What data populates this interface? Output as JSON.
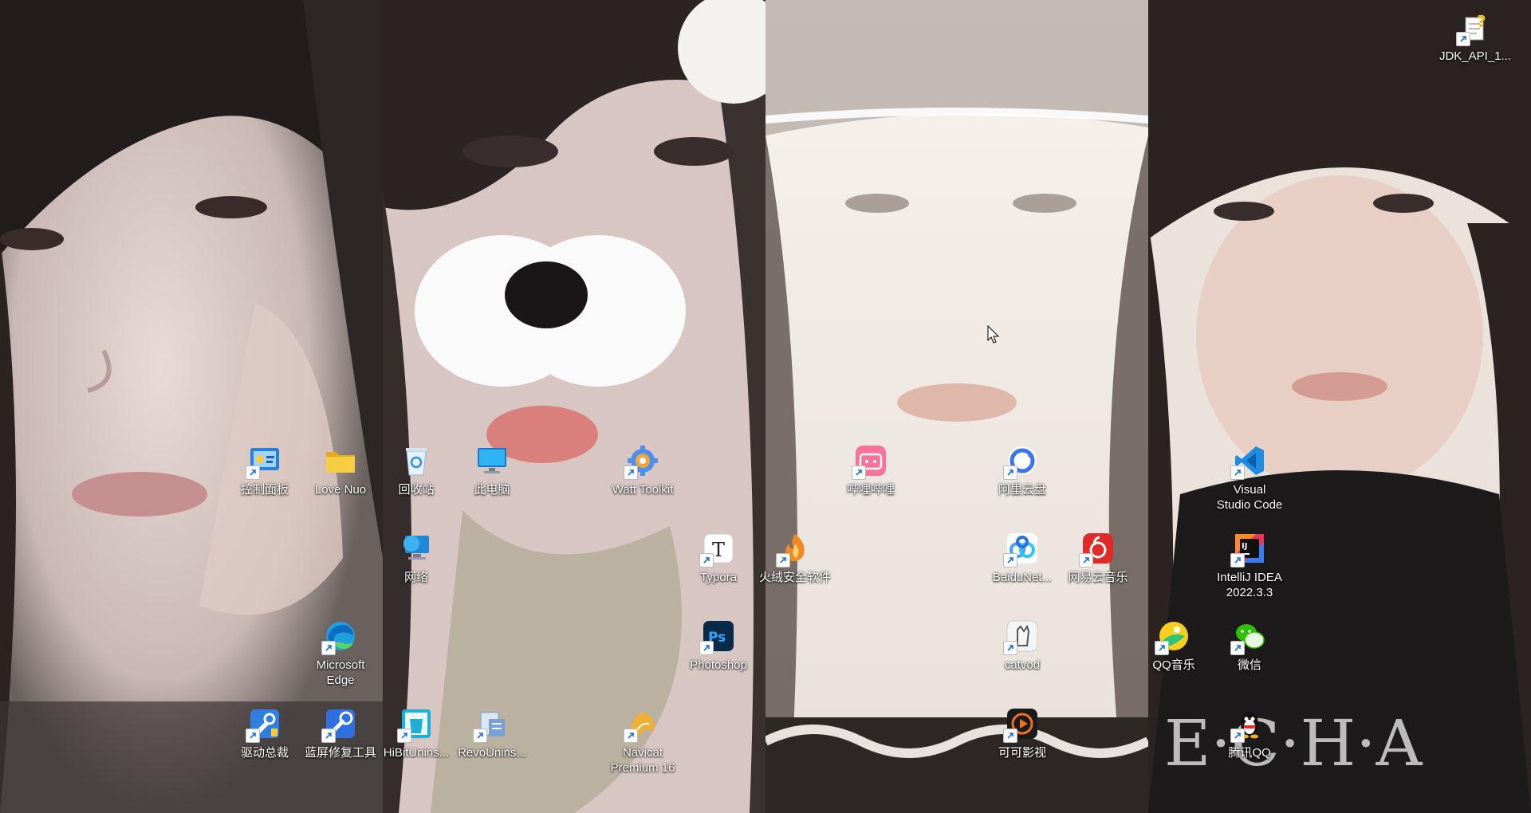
{
  "desktop": {
    "icons": [
      {
        "id": "control-panel",
        "label": "控制面板",
        "icon": "control-panel-icon",
        "shortcut": true,
        "color": "#2a7fd8"
      },
      {
        "id": "love-nuo",
        "label": "Love Nuo",
        "icon": "folder-icon",
        "shortcut": false,
        "color": "#f3c13a"
      },
      {
        "id": "recycle-bin",
        "label": "回收站",
        "icon": "recycle-bin-icon",
        "shortcut": false,
        "color": "#4aa2e8"
      },
      {
        "id": "this-pc",
        "label": "此电脑",
        "icon": "computer-icon",
        "shortcut": false,
        "color": "#2da6ef"
      },
      {
        "id": "watt-toolkit",
        "label": "Watt Toolkit",
        "icon": "gear-icon",
        "shortcut": true,
        "color": "#4b8ef0"
      },
      {
        "id": "bilibili",
        "label": "哔哩哔哩",
        "icon": "bilibili-icon",
        "shortcut": true,
        "color": "#fb7299"
      },
      {
        "id": "aliyun-drive",
        "label": "阿里云盘",
        "icon": "cloud-drive-icon",
        "shortcut": true,
        "color": "#3b73f0"
      },
      {
        "id": "vscode",
        "label": "Visual\nStudio Code",
        "icon": "vscode-icon",
        "shortcut": true,
        "color": "#1e8ce3"
      },
      {
        "id": "network",
        "label": "网络",
        "icon": "network-icon",
        "shortcut": false,
        "color": "#1f87d6"
      },
      {
        "id": "typora",
        "label": "Typora",
        "icon": "typora-icon",
        "shortcut": true,
        "color": "#ffffff"
      },
      {
        "id": "huorong",
        "label": "火绒安全软件",
        "icon": "huorong-icon",
        "shortcut": true,
        "color": "#f08a24"
      },
      {
        "id": "baidunet",
        "label": "BaiduNet...",
        "icon": "baidu-netdisk-icon",
        "shortcut": true,
        "color": "#4a9ff5"
      },
      {
        "id": "netease-music",
        "label": "网易云音乐",
        "icon": "netease-music-icon",
        "shortcut": true,
        "color": "#e02a2a"
      },
      {
        "id": "intellij",
        "label": "IntelliJ IDEA\n2022.3.3",
        "icon": "intellij-icon",
        "shortcut": true,
        "color": "#e8355b"
      },
      {
        "id": "edge",
        "label": "Microsoft\nEdge",
        "icon": "edge-icon",
        "shortcut": true,
        "color": "#1fa0dc"
      },
      {
        "id": "photoshop",
        "label": "Photoshop",
        "icon": "photoshop-icon",
        "shortcut": true,
        "color": "#0a2a4a"
      },
      {
        "id": "catvod",
        "label": "catvod",
        "icon": "catvod-icon",
        "shortcut": true,
        "color": "#f5f5f5"
      },
      {
        "id": "qq-music",
        "label": "QQ音乐",
        "icon": "qq-music-icon",
        "shortcut": true,
        "color": "#f7d01f"
      },
      {
        "id": "wechat",
        "label": "微信",
        "icon": "wechat-icon",
        "shortcut": true,
        "color": "#2dc100"
      },
      {
        "id": "driver-master",
        "label": "驱动总裁",
        "icon": "driver-icon",
        "shortcut": true,
        "color": "#2f7ee0"
      },
      {
        "id": "bluescreen-fix",
        "label": "蓝屏修复工具",
        "icon": "repair-tool-icon",
        "shortcut": true,
        "color": "#2f6fe0"
      },
      {
        "id": "hibit",
        "label": "HiBitUnins...",
        "icon": "hibit-uninstaller-icon",
        "shortcut": true,
        "color": "#1fb0d8"
      },
      {
        "id": "revo",
        "label": "RevoUnins...",
        "icon": "revo-uninstaller-icon",
        "shortcut": true,
        "color": "#7aa0d8"
      },
      {
        "id": "navicat",
        "label": "Navicat\nPremium 16",
        "icon": "navicat-icon",
        "shortcut": true,
        "color": "#f0b030"
      },
      {
        "id": "kuke",
        "label": "可可影视",
        "icon": "video-player-icon",
        "shortcut": true,
        "color": "#f07020"
      },
      {
        "id": "qq",
        "label": "腾讯QQ",
        "icon": "qq-penguin-icon",
        "shortcut": true,
        "color": "#111111"
      },
      {
        "id": "jdk-api",
        "label": "JDK_API_1...",
        "icon": "help-file-icon",
        "shortcut": true,
        "color": "#f2c200"
      }
    ]
  }
}
